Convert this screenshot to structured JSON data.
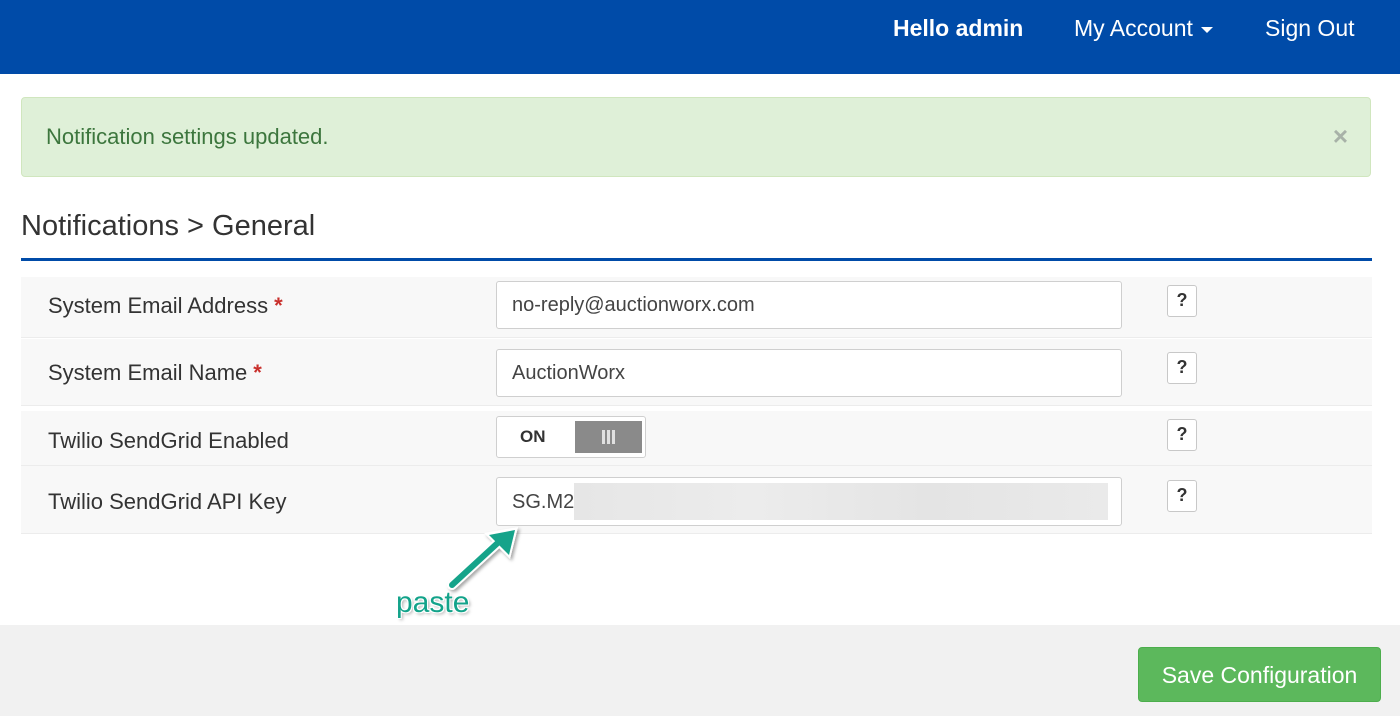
{
  "nav": {
    "greeting": "Hello admin",
    "account_label": "My Account",
    "signout_label": "Sign Out",
    "bg_color": "#004ba8"
  },
  "alert": {
    "message": "Notification settings updated.",
    "close_symbol": "×"
  },
  "page_title": "Notifications > General",
  "form": {
    "rows": [
      {
        "label": "System Email Address",
        "required_mark": "*",
        "value": "no-reply@auctionworx.com",
        "help": "?"
      },
      {
        "label": "System Email Name",
        "required_mark": "*",
        "value": "AuctionWorx",
        "help": "?"
      },
      {
        "label": "Twilio SendGrid Enabled",
        "toggle_state": "ON",
        "help": "?"
      },
      {
        "label": "Twilio SendGrid API Key",
        "value_visible": "SG.M2",
        "help": "?"
      }
    ]
  },
  "annotation": {
    "text": "paste",
    "color": "#13a38a"
  },
  "footer": {
    "save_label": "Save Configuration",
    "button_color": "#5cb85c"
  }
}
